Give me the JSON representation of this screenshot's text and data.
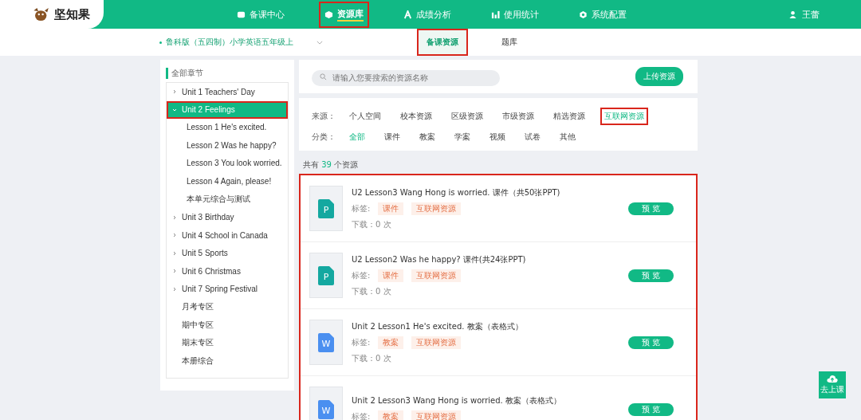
{
  "logo": {
    "text": "坚知果"
  },
  "nav": [
    {
      "label": "备课中心",
      "kind": "folder",
      "selected": false,
      "highlighted": false
    },
    {
      "label": "资源库",
      "kind": "cube",
      "selected": true,
      "highlighted": true
    },
    {
      "label": "成绩分析",
      "kind": "letter",
      "selected": false,
      "highlighted": false
    },
    {
      "label": "使用统计",
      "kind": "bars",
      "selected": false,
      "highlighted": false
    },
    {
      "label": "系统配置",
      "kind": "gear",
      "selected": false,
      "highlighted": false
    }
  ],
  "user": {
    "name": "王蕾"
  },
  "textbook": {
    "value": "鲁科版（五四制）小学英语五年级上"
  },
  "subtabs": [
    {
      "label": "备课资源",
      "selected": true,
      "highlighted": true
    },
    {
      "label": "题库",
      "selected": false,
      "highlighted": false
    }
  ],
  "sidebar": {
    "title": "全部章节",
    "items": [
      {
        "label": "Unit 1 Teachers' Day",
        "kind": "unit",
        "expanded": false,
        "selected": false,
        "highlighted": false
      },
      {
        "label": "Unit 2 Feelings",
        "kind": "unit",
        "expanded": true,
        "selected": true,
        "highlighted": true,
        "children": [
          {
            "label": "Lesson 1 He's excited.",
            "selected": false
          },
          {
            "label": "Lesson 2 Was he happy?",
            "selected": false
          },
          {
            "label": "Lesson 3 You look worried.",
            "selected": false
          },
          {
            "label": "Lesson 4 Again, please!",
            "selected": false
          },
          {
            "label": "本单元综合与测试",
            "selected": false
          }
        ]
      },
      {
        "label": "Unit 3 Birthday",
        "kind": "unit",
        "expanded": false,
        "selected": false,
        "highlighted": false
      },
      {
        "label": "Unit 4 School in Canada",
        "kind": "unit",
        "expanded": false,
        "selected": false,
        "highlighted": false
      },
      {
        "label": "Unit 5 Sports",
        "kind": "unit",
        "expanded": false,
        "selected": false,
        "highlighted": false
      },
      {
        "label": "Unit 6 Christmas",
        "kind": "unit",
        "expanded": false,
        "selected": false,
        "highlighted": false
      },
      {
        "label": "Unit 7 Spring Festival",
        "kind": "unit",
        "expanded": false,
        "selected": false,
        "highlighted": false
      },
      {
        "label": "月考专区",
        "kind": "section",
        "selected": false,
        "highlighted": false
      },
      {
        "label": "期中专区",
        "kind": "section",
        "selected": false,
        "highlighted": false
      },
      {
        "label": "期末专区",
        "kind": "section",
        "selected": false,
        "highlighted": false
      },
      {
        "label": "本册综合",
        "kind": "section",
        "selected": false,
        "highlighted": false
      }
    ]
  },
  "search": {
    "placeholder": "请输入您要搜索的资源名称"
  },
  "upload_button": "上传资源",
  "filters": [
    {
      "label": "来源：",
      "options": [
        {
          "label": "个人空间",
          "selected": false,
          "highlighted": false
        },
        {
          "label": "校本资源",
          "selected": false,
          "highlighted": false
        },
        {
          "label": "区级资源",
          "selected": false,
          "highlighted": false
        },
        {
          "label": "市级资源",
          "selected": false,
          "highlighted": false
        },
        {
          "label": "精选资源",
          "selected": false,
          "highlighted": false
        },
        {
          "label": "互联网资源",
          "selected": true,
          "highlighted": true
        }
      ]
    },
    {
      "label": "分类：",
      "options": [
        {
          "label": "全部",
          "selected": true,
          "highlighted": false
        },
        {
          "label": "课件",
          "selected": false,
          "highlighted": false
        },
        {
          "label": "教案",
          "selected": false,
          "highlighted": false
        },
        {
          "label": "学案",
          "selected": false,
          "highlighted": false
        },
        {
          "label": "视频",
          "selected": false,
          "highlighted": false
        },
        {
          "label": "试卷",
          "selected": false,
          "highlighted": false
        },
        {
          "label": "其他",
          "selected": false,
          "highlighted": false
        }
      ]
    }
  ],
  "count": {
    "prefix": "共有",
    "number": "39",
    "suffix": "个资源"
  },
  "resources": {
    "highlighted": true,
    "items": [
      {
        "kind": "ppt",
        "file_letter": "P",
        "title": "U2 Lesson3 Wang Hong is worried. 课件（共50张PPT)",
        "tags_label": "标签:",
        "tags": [
          "课件",
          "互联网资源"
        ],
        "downloads": "下载：0 次",
        "button": "预 览"
      },
      {
        "kind": "ppt",
        "file_letter": "P",
        "title": "U2 Lesson2 Was he happy?  课件(共24张PPT)",
        "tags_label": "标签:",
        "tags": [
          "课件",
          "互联网资源"
        ],
        "downloads": "下载：0 次",
        "button": "预 览"
      },
      {
        "kind": "doc",
        "file_letter": "W",
        "title": "Unit 2 Lesson1 He's excited. 教案（表格式）",
        "tags_label": "标签:",
        "tags": [
          "教案",
          "互联网资源"
        ],
        "downloads": "下载：0 次",
        "button": "预 览"
      },
      {
        "kind": "doc",
        "file_letter": "W",
        "title": "Unit 2 Lesson3 Wang Hong is worried. 教案（表格式）",
        "tags_label": "标签:",
        "tags": [
          "教案",
          "互联网资源"
        ],
        "button": "预 览"
      }
    ]
  },
  "float_button": {
    "label": "去上课"
  }
}
